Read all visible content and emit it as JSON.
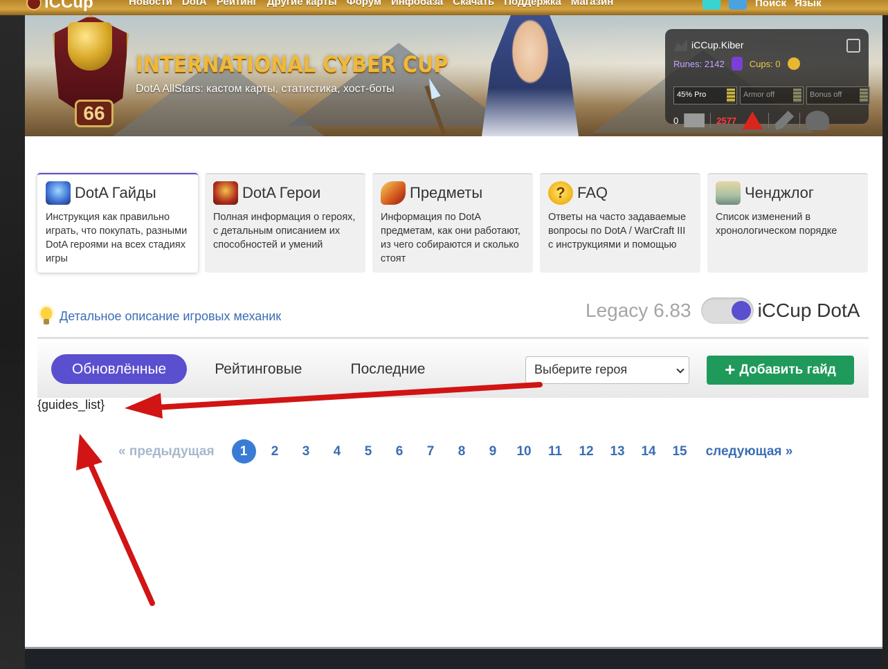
{
  "topnav": {
    "logo": "iCCup",
    "items": [
      "Новости",
      "DotA",
      "Рейтинг",
      "Другие карты",
      "Форум",
      "Инфобаза",
      "Скачать",
      "Поддержка",
      "Магазин"
    ],
    "search": "Поиск",
    "language": "Язык"
  },
  "banner": {
    "title": "INTERNATIONAL CYBER CUP",
    "subtitle": "DotA AllStars: кастом карты, статистика, хост-боты",
    "level": "66"
  },
  "user": {
    "name": "iCCup.Kiber",
    "runes_label": "Runes: 2142",
    "cups_label": "Cups: 0",
    "toggles": [
      "45% Pro",
      "Armor off",
      "Bonus off"
    ],
    "mail_count": "0",
    "warn_count": "2577"
  },
  "cards": [
    {
      "icon": "spellbook-icon",
      "title": "DotA Гайды",
      "desc": "Инструкция как правильно играть, что покупать, разными DotA героями на всех стадиях игры"
    },
    {
      "icon": "hero-emblem-icon",
      "title": "DotA Герои",
      "desc": "Полная информация о героях, с детальным описанием их способностей и умений"
    },
    {
      "icon": "items-icon",
      "title": "Предметы",
      "desc": "Информация по DotA предметам, как они работают, из чего собираются и сколько стоят"
    },
    {
      "icon": "faq-icon",
      "title": "FAQ",
      "desc": "Ответы на часто задаваемые вопросы по DotA / WarCraft III с инструкциями и помощью"
    },
    {
      "icon": "changelog-scroll-icon",
      "title": "Ченджлог",
      "desc": "Список изменений в хронологическом порядке"
    }
  ],
  "faq_icon_glyph": "?",
  "mechanics_link": "Детальное описание игровых механик",
  "version": {
    "legacy": "Legacy 6.83",
    "current": "iCCup DotA"
  },
  "guides": {
    "tabs": [
      "Обновлённые",
      "Рейтинговые",
      "Последние"
    ],
    "hero_select_placeholder": "Выберите героя",
    "add_button": "Добавить гайд",
    "placeholder": "{guides_list}"
  },
  "pager": {
    "prev": "« предыдущая",
    "pages": [
      "1",
      "2",
      "3",
      "4",
      "5",
      "6",
      "7",
      "8",
      "9",
      "10",
      "11",
      "12",
      "13",
      "14",
      "15"
    ],
    "current": "1",
    "next": "следующая »"
  },
  "colors": {
    "accent": "#5a4fcf",
    "add_button": "#1f9a5a",
    "link": "#3a6db4",
    "annotation_arrow": "#d11414"
  }
}
